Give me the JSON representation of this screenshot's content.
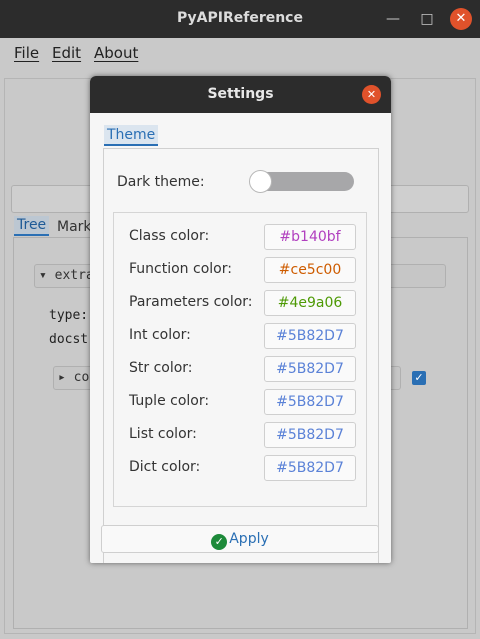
{
  "window": {
    "title": "PyAPIReference",
    "minimize_glyph": "—",
    "maximize_glyph": "□",
    "close_glyph": "✕"
  },
  "menu": {
    "file": "File",
    "edit": "Edit",
    "about": "About"
  },
  "background": {
    "tabs": [
      "Tree",
      "Mark"
    ],
    "expander_label": "extra",
    "type_label": "type:",
    "docstring_label": "docstr",
    "sub_expander_label": "cor"
  },
  "dialog": {
    "title": "Settings",
    "close_glyph": "✕",
    "tab_label": "Theme",
    "dark_theme_label": "Dark theme:",
    "dark_theme_on": false,
    "colors": [
      {
        "label": "Class color:",
        "value": "#b140bf",
        "color": "#b140bf"
      },
      {
        "label": "Function color:",
        "value": "#ce5c00",
        "color": "#ce5c00"
      },
      {
        "label": "Parameters color:",
        "value": "#4e9a06",
        "color": "#4e9a06"
      },
      {
        "label": "Int color:",
        "value": "#5B82D7",
        "color": "#5B82D7"
      },
      {
        "label": "Str color:",
        "value": "#5B82D7",
        "color": "#5B82D7"
      },
      {
        "label": "Tuple color:",
        "value": "#5B82D7",
        "color": "#5B82D7"
      },
      {
        "label": "List color:",
        "value": "#5B82D7",
        "color": "#5B82D7"
      },
      {
        "label": "Dict color:",
        "value": "#5B82D7",
        "color": "#5B82D7"
      }
    ],
    "apply_label": "Apply",
    "apply_icon": "check-circle-icon"
  }
}
